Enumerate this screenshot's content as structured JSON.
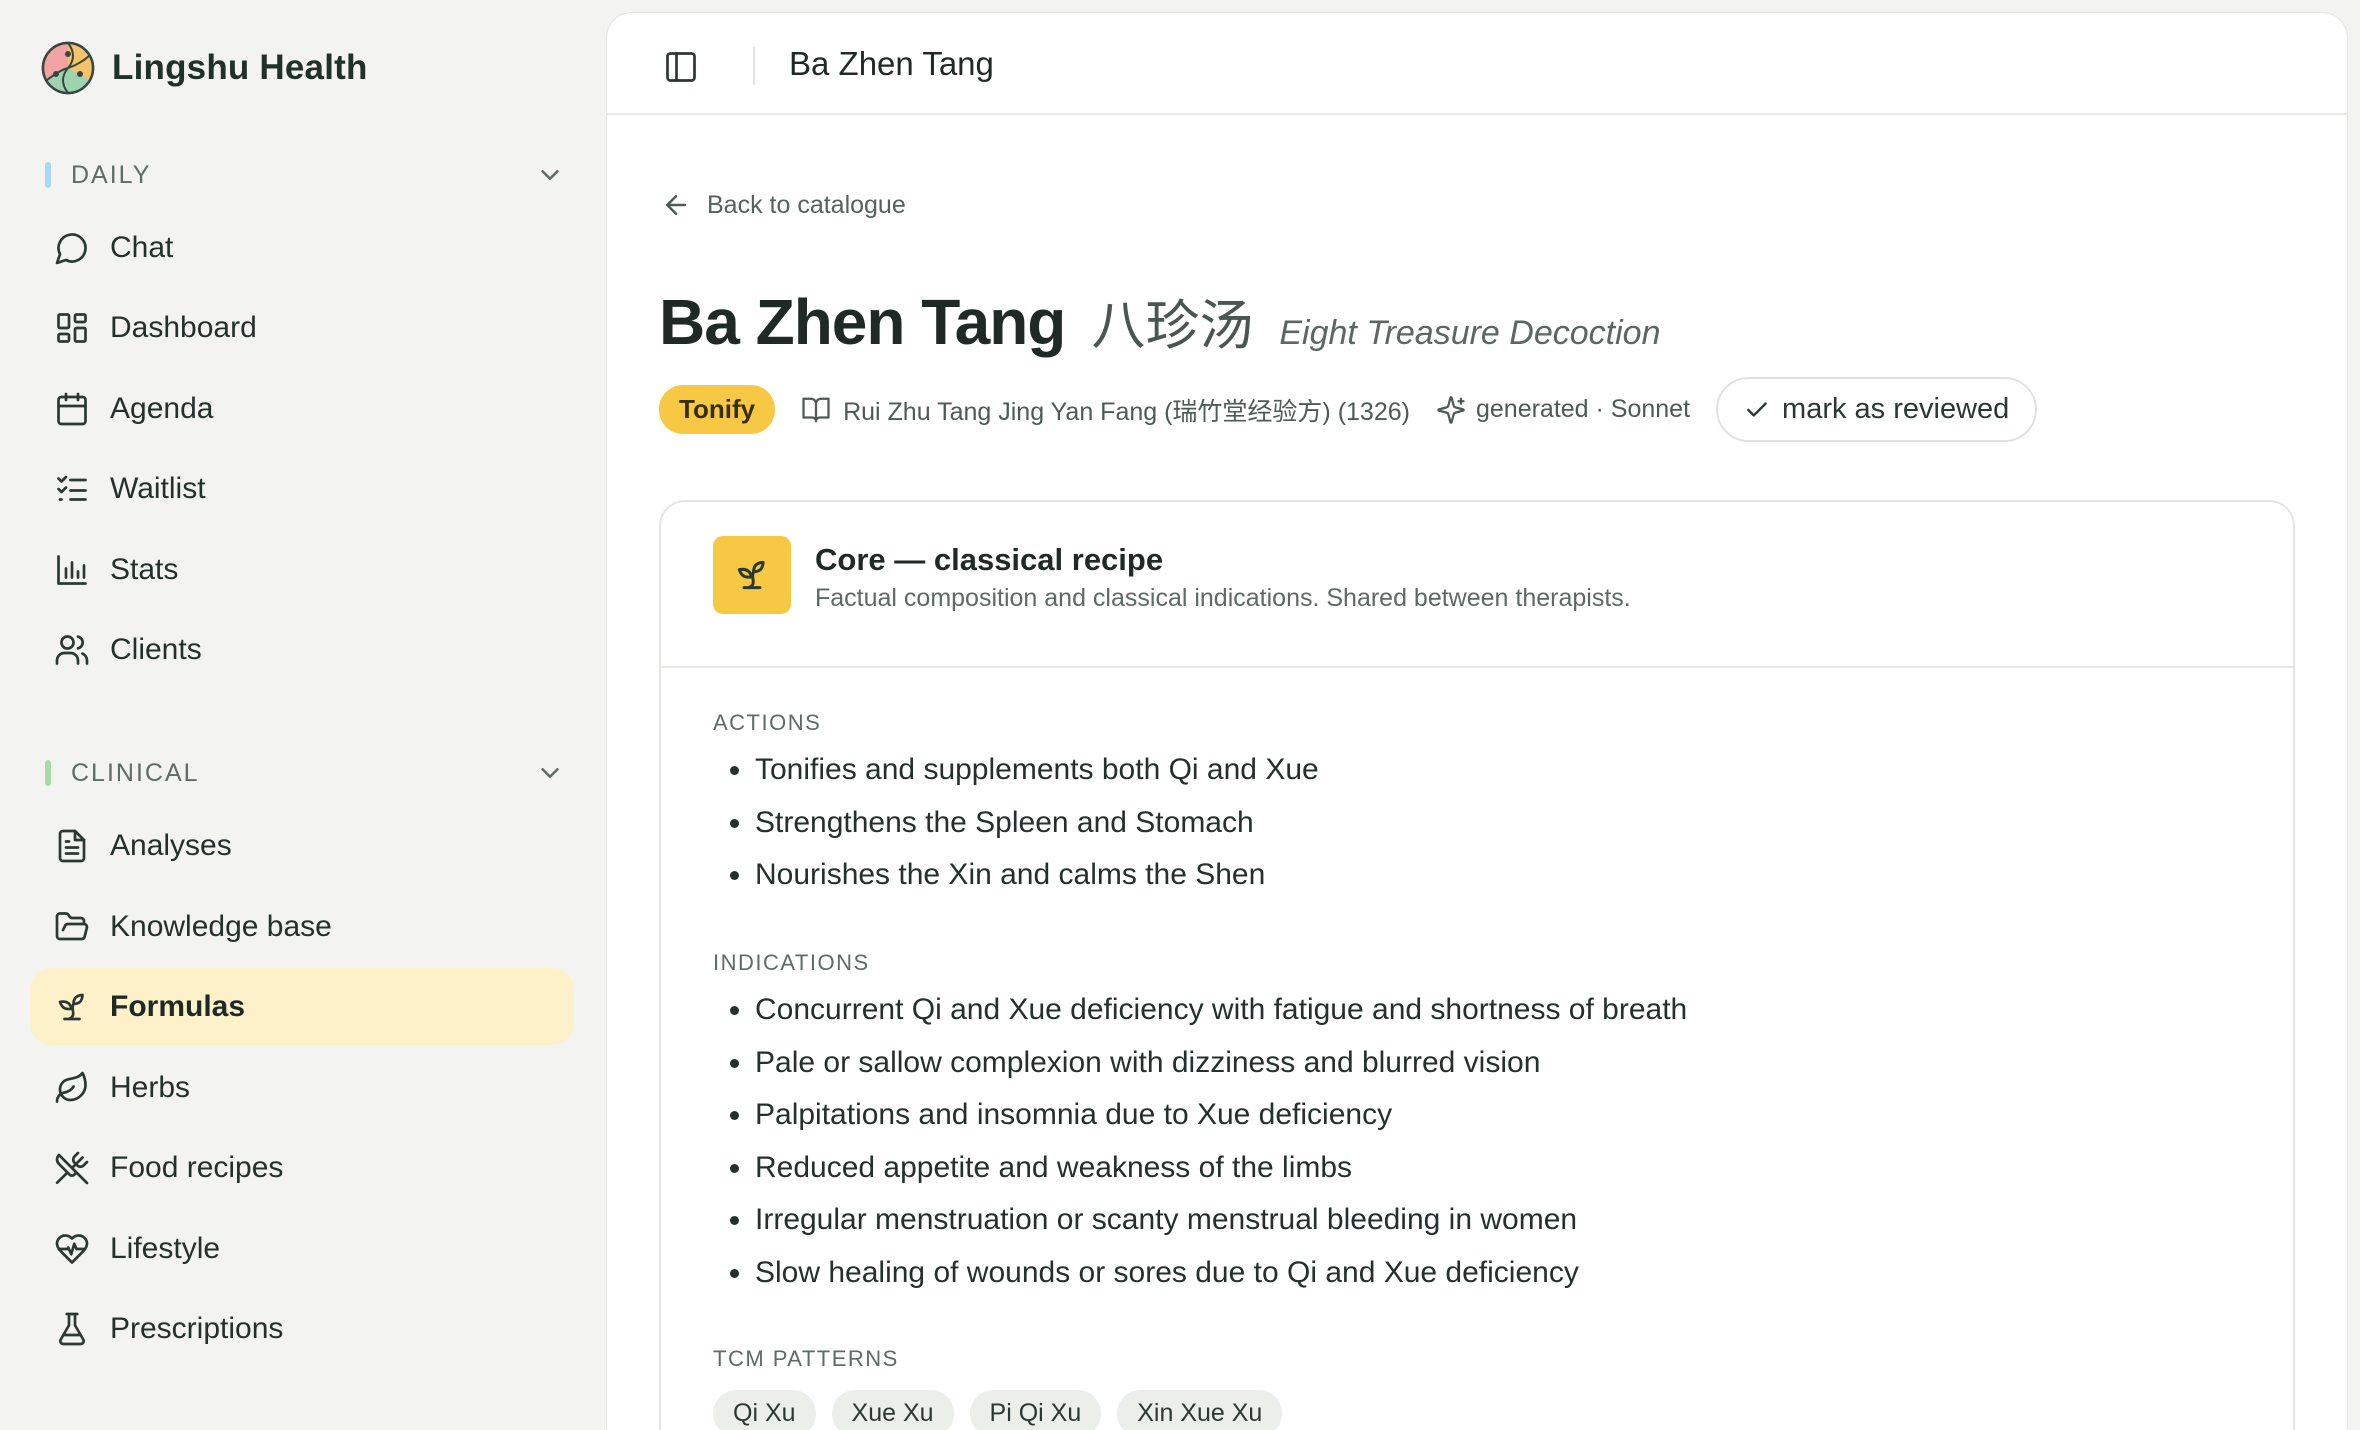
{
  "brand": {
    "name": "Lingshu Health"
  },
  "sidebar": {
    "sections": [
      {
        "label": "DAILY",
        "bar_color": "#a9d8f2"
      },
      {
        "label": "CLINICAL",
        "bar_color": "#a7dca6"
      }
    ],
    "daily_items": [
      {
        "label": "Chat",
        "icon": "chat-bubble-icon"
      },
      {
        "label": "Dashboard",
        "icon": "dashboard-grid-icon"
      },
      {
        "label": "Agenda",
        "icon": "calendar-icon"
      },
      {
        "label": "Waitlist",
        "icon": "checklist-icon"
      },
      {
        "label": "Stats",
        "icon": "bar-chart-icon"
      },
      {
        "label": "Clients",
        "icon": "users-icon"
      }
    ],
    "clinical_items": [
      {
        "label": "Analyses",
        "icon": "document-icon"
      },
      {
        "label": "Knowledge base",
        "icon": "folder-open-icon"
      },
      {
        "label": "Formulas",
        "icon": "sprout-icon",
        "active": true
      },
      {
        "label": "Herbs",
        "icon": "leaf-icon"
      },
      {
        "label": "Food recipes",
        "icon": "utensils-crossed-icon"
      },
      {
        "label": "Lifestyle",
        "icon": "heart-pulse-icon"
      },
      {
        "label": "Prescriptions",
        "icon": "flask-icon"
      }
    ]
  },
  "topbar": {
    "title": "Ba Zhen Tang"
  },
  "back_link": {
    "label": "Back to catalogue"
  },
  "formula": {
    "name": "Ba Zhen Tang",
    "chinese": "八珍汤",
    "english": "Eight Treasure Decoction",
    "category": "Tonify",
    "source": "Rui Zhu Tang Jing Yan Fang (瑞竹堂经验方) (1326)",
    "generation": "generated · Sonnet",
    "review_button": "mark as reviewed"
  },
  "core_card": {
    "title": "Core — classical recipe",
    "subtitle": "Factual composition and classical indications. Shared between therapists.",
    "actions_label": "ACTIONS",
    "actions": [
      "Tonifies and supplements both Qi and Xue",
      "Strengthens the Spleen and Stomach",
      "Nourishes the Xin and calms the Shen"
    ],
    "indications_label": "INDICATIONS",
    "indications": [
      "Concurrent Qi and Xue deficiency with fatigue and shortness of breath",
      "Pale or sallow complexion with dizziness and blurred vision",
      "Palpitations and insomnia due to Xue deficiency",
      "Reduced appetite and weakness of the limbs",
      "Irregular menstruation or scanty menstrual bleeding in women",
      "Slow healing of wounds or sores due to Qi and Xue deficiency"
    ],
    "patterns_label": "TCM PATTERNS",
    "patterns": [
      "Qi Xu",
      "Xue Xu",
      "Pi Qi Xu",
      "Xin Xue Xu"
    ]
  },
  "colors": {
    "accent_yellow": "#f7c844",
    "active_nav_bg": "#fdf1c9",
    "sidebar_bg": "#f3f4f1"
  }
}
